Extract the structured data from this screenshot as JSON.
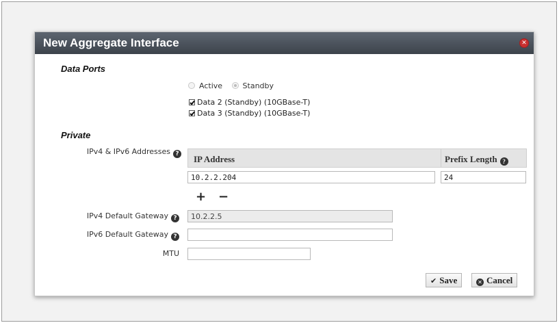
{
  "dialog": {
    "title": "New Aggregate Interface",
    "close_icon": "close-icon"
  },
  "data_ports": {
    "section_title": "Data Ports",
    "radio_active_label": "Active",
    "radio_standby_label": "Standby",
    "selected_mode": "Standby",
    "ports": [
      {
        "label": "Data 2 (Standby) (10GBase-T)",
        "checked": true
      },
      {
        "label": "Data 3 (Standby) (10GBase-T)",
        "checked": true
      }
    ]
  },
  "private": {
    "section_title": "Private",
    "addresses_label": "IPv4 & IPv6 Addresses",
    "table": {
      "col_ip": "IP Address",
      "col_prefix": "Prefix Length",
      "rows": [
        {
          "ip": "10.2.2.204",
          "prefix": "24"
        }
      ]
    },
    "add_label": "+",
    "remove_label": "−",
    "ipv4_gateway_label": "IPv4 Default Gateway",
    "ipv4_gateway_value": "10.2.2.5",
    "ipv6_gateway_label": "IPv6 Default Gateway",
    "ipv6_gateway_value": "",
    "mtu_label": "MTU",
    "mtu_value": ""
  },
  "buttons": {
    "save_label": "Save",
    "cancel_label": "Cancel"
  }
}
